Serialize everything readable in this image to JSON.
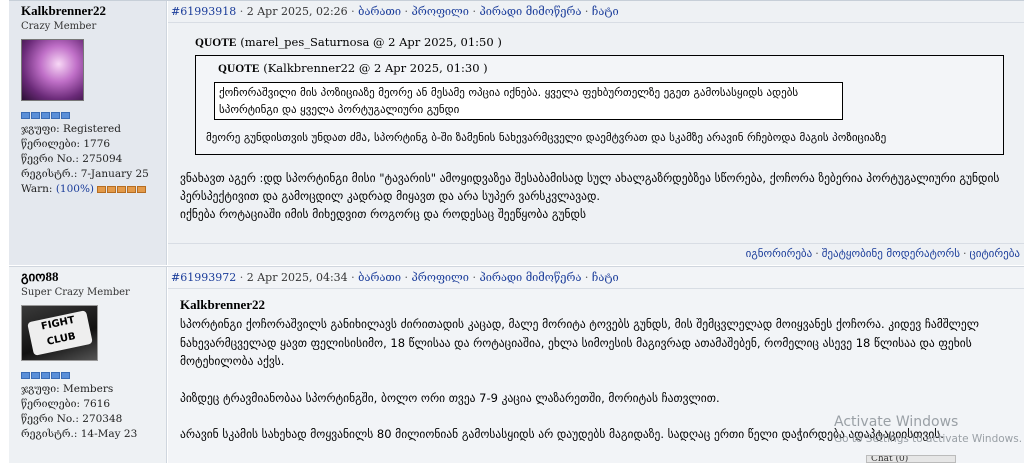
{
  "posts": [
    {
      "author": "Kalkbrenner22",
      "rank": "Crazy Member",
      "group_label": "ჯგუფი:",
      "group": "Registered",
      "posts_label": "წერილები:",
      "posts_count": "1776",
      "member_label": "წევრი No.:",
      "member_no": "275094",
      "reg_label": "რეგისტრ.:",
      "reg_date": "7-January 25",
      "warn_label": "Warn:",
      "warn_value": "(100%)",
      "post_id": "#61993918",
      "date": "2 Apr 2025, 02:26",
      "actions": [
        "ბარათი",
        "პროფილი",
        "პირადი მიმოწერა",
        "ჩატი"
      ],
      "quote_outer_label": "QUOTE",
      "quote_outer_meta": "(marel_pes_Saturnosa @ 2 Apr 2025, 01:50 )",
      "quote_inner_label": "QUOTE",
      "quote_inner_meta": "(Kalkbrenner22 @ 2 Apr 2025, 01:30 )",
      "quote_inner_text": "ქოჩორაშვილი მის პოზიციაზე მეორე ან მესამე ოპცია იქნება. ყველა ფეხბურთელზე ეგეთ გამოსასყიდს ადებს სპორტინგი და ყველა პორტუგალიური გუნდი",
      "quote_outer_text": "მეორე გუნდისთვის უნდათ ძმა, სპორტინგ ბ-ში ზამენის ნახევარმცველი დაემტვრათ და სკამზე არავინ რჩებოდა მაგის პოზიციაზე",
      "body": [
        "ვნახავთ აგერ :დდ სპორტინგი მისი \"ტავარის\" ამოყიდვაზეა შესაბამისად სულ ახალგაზრდებზეა სწორება, ქოჩორა ზებერია პორტუგალიური გუნდის პერსპექტივით და გამოცდილ კადრად მიყავთ და არა სუპერ ვარსკვლავად.",
        "იქნება როტაციაში იმის მიხედვით როგორც და როდესაც შეეწყობა გუნდს"
      ],
      "footer": [
        "იგნორირება",
        "შეატყობინე მოდერატორს",
        "ციტირება"
      ]
    },
    {
      "author": "გიო88",
      "rank": "Super Crazy Member",
      "avatar_text": "FIGHT CLUB",
      "group_label": "ჯგუფი:",
      "group": "Members",
      "posts_label": "წერილები:",
      "posts_count": "7616",
      "member_label": "წევრი No.:",
      "member_no": "270348",
      "reg_label": "რეგისტრ.:",
      "reg_date": "14-May 23",
      "post_id": "#61993972",
      "date": "2 Apr 2025, 04:34",
      "actions": [
        "ბარათი",
        "პროფილი",
        "პირადი მიმოწერა",
        "ჩატი"
      ],
      "title": "Kalkbrenner22",
      "body": [
        "სპორტინგი ქოჩორაშვილს განიხილავს ძირითადის კაცად, მალე მორიტა ტოვებს გუნდს, მის შემცვლელად მოიყვანეს ქოჩორა. კიდევ ჩამშლელ ნახევარმცველად ყავთ ფელისისიმო, 18 წლისაა და როტაციაშია, ეხლა სიმოესის მაგივრად ათამაშებენ, რომელიც ასევე 18 წლისაა და ფეხის მოტეხილობა აქვს.",
        "პიზდეც ტრავმიანობაა სპორტინგში, ბოლო ორი თვეა 7-9 კაცია ლაზარეთში, მორიტას ჩათვლით.",
        "არავინ სკამის სახეხად მოყვანილს 80 მილიონიან გამოსასყიდს არ დაუდებს მაგიდაზე. სადღაც ერთი წელი დაჭირდება ადაპტაციისთვის."
      ]
    }
  ],
  "watermark": {
    "line1": "Activate Windows",
    "line2": "Go to Settings to activate Windows."
  },
  "chat_bar": "Chat (0)"
}
